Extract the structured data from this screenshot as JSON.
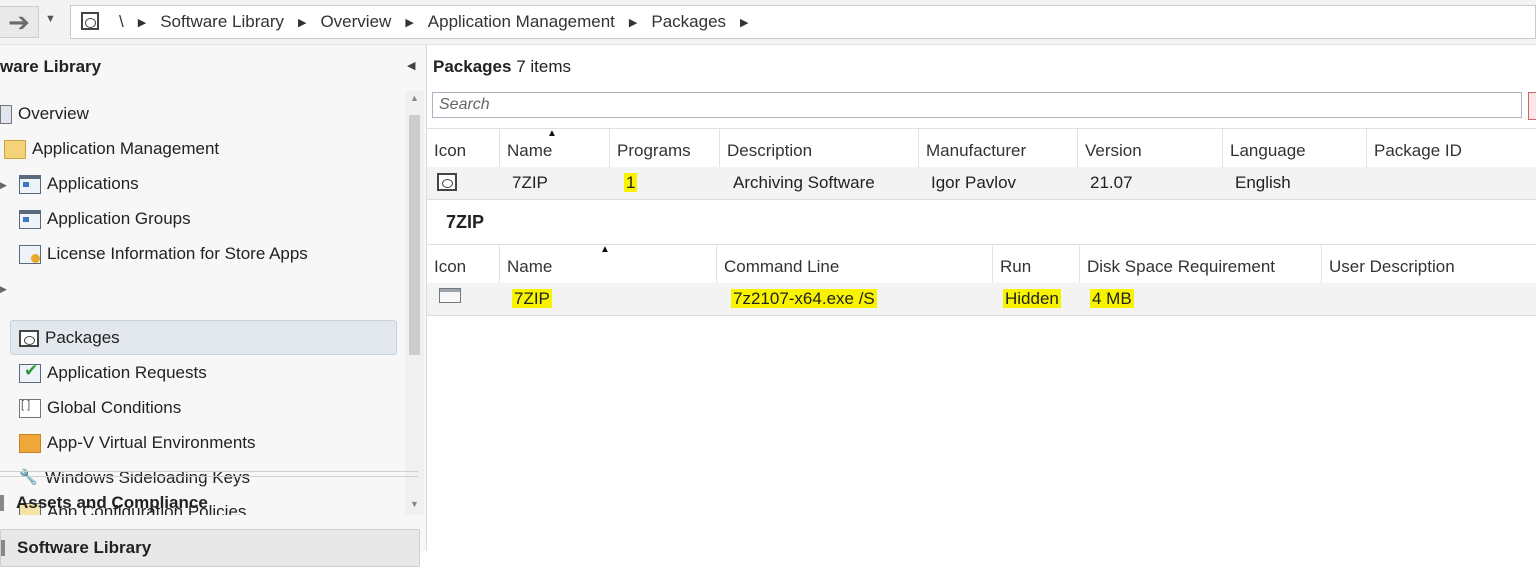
{
  "address": {
    "root": "\\",
    "crumbs": [
      "Software Library",
      "Overview",
      "Application Management",
      "Packages"
    ]
  },
  "left_panel": {
    "title": "ware Library",
    "tree": [
      {
        "label": "Overview",
        "icon": "overview-icon"
      },
      {
        "label": "Application Management",
        "icon": "folder-icon"
      },
      {
        "label": "Applications",
        "icon": "application-icon"
      },
      {
        "label": "Application Groups",
        "icon": "application-group-icon"
      },
      {
        "label": "License Information for Store Apps",
        "icon": "license-icon"
      },
      {
        "label": "Packages",
        "icon": "package-icon"
      },
      {
        "label": "Application Requests",
        "icon": "request-icon"
      },
      {
        "label": "Global Conditions",
        "icon": "global-conditions-icon"
      },
      {
        "label": "App-V Virtual Environments",
        "icon": "appv-icon"
      },
      {
        "label": "Windows Sideloading Keys",
        "icon": "keys-icon"
      },
      {
        "label": "App Configuration Policies",
        "icon": "config-policy-icon"
      }
    ],
    "workspaces": [
      "Assets and Compliance",
      "Software Library"
    ]
  },
  "right_panel": {
    "title_bold": "Packages",
    "title_count": "7 items",
    "search_placeholder": "Search",
    "packages_columns": [
      "Icon",
      "Name",
      "Programs",
      "Description",
      "Manufacturer",
      "Version",
      "Language",
      "Package ID"
    ],
    "packages_rows": [
      {
        "name": "7ZIP",
        "programs": "1",
        "description": "Archiving Software",
        "manufacturer": "Igor Pavlov",
        "version": "21.07",
        "language": "English"
      }
    ],
    "detail_title": "7ZIP",
    "programs_columns": [
      "Icon",
      "Name",
      "Command Line",
      "Run",
      "Disk Space Requirement",
      "User Description"
    ],
    "programs_rows": [
      {
        "name": "7ZIP",
        "command_line": "7z2107-x64.exe /S",
        "run": "Hidden",
        "disk_space": "4 MB",
        "user_description": ""
      }
    ]
  },
  "colors": {
    "highlight": "#f8f400",
    "selection": "#e3e8ee"
  }
}
